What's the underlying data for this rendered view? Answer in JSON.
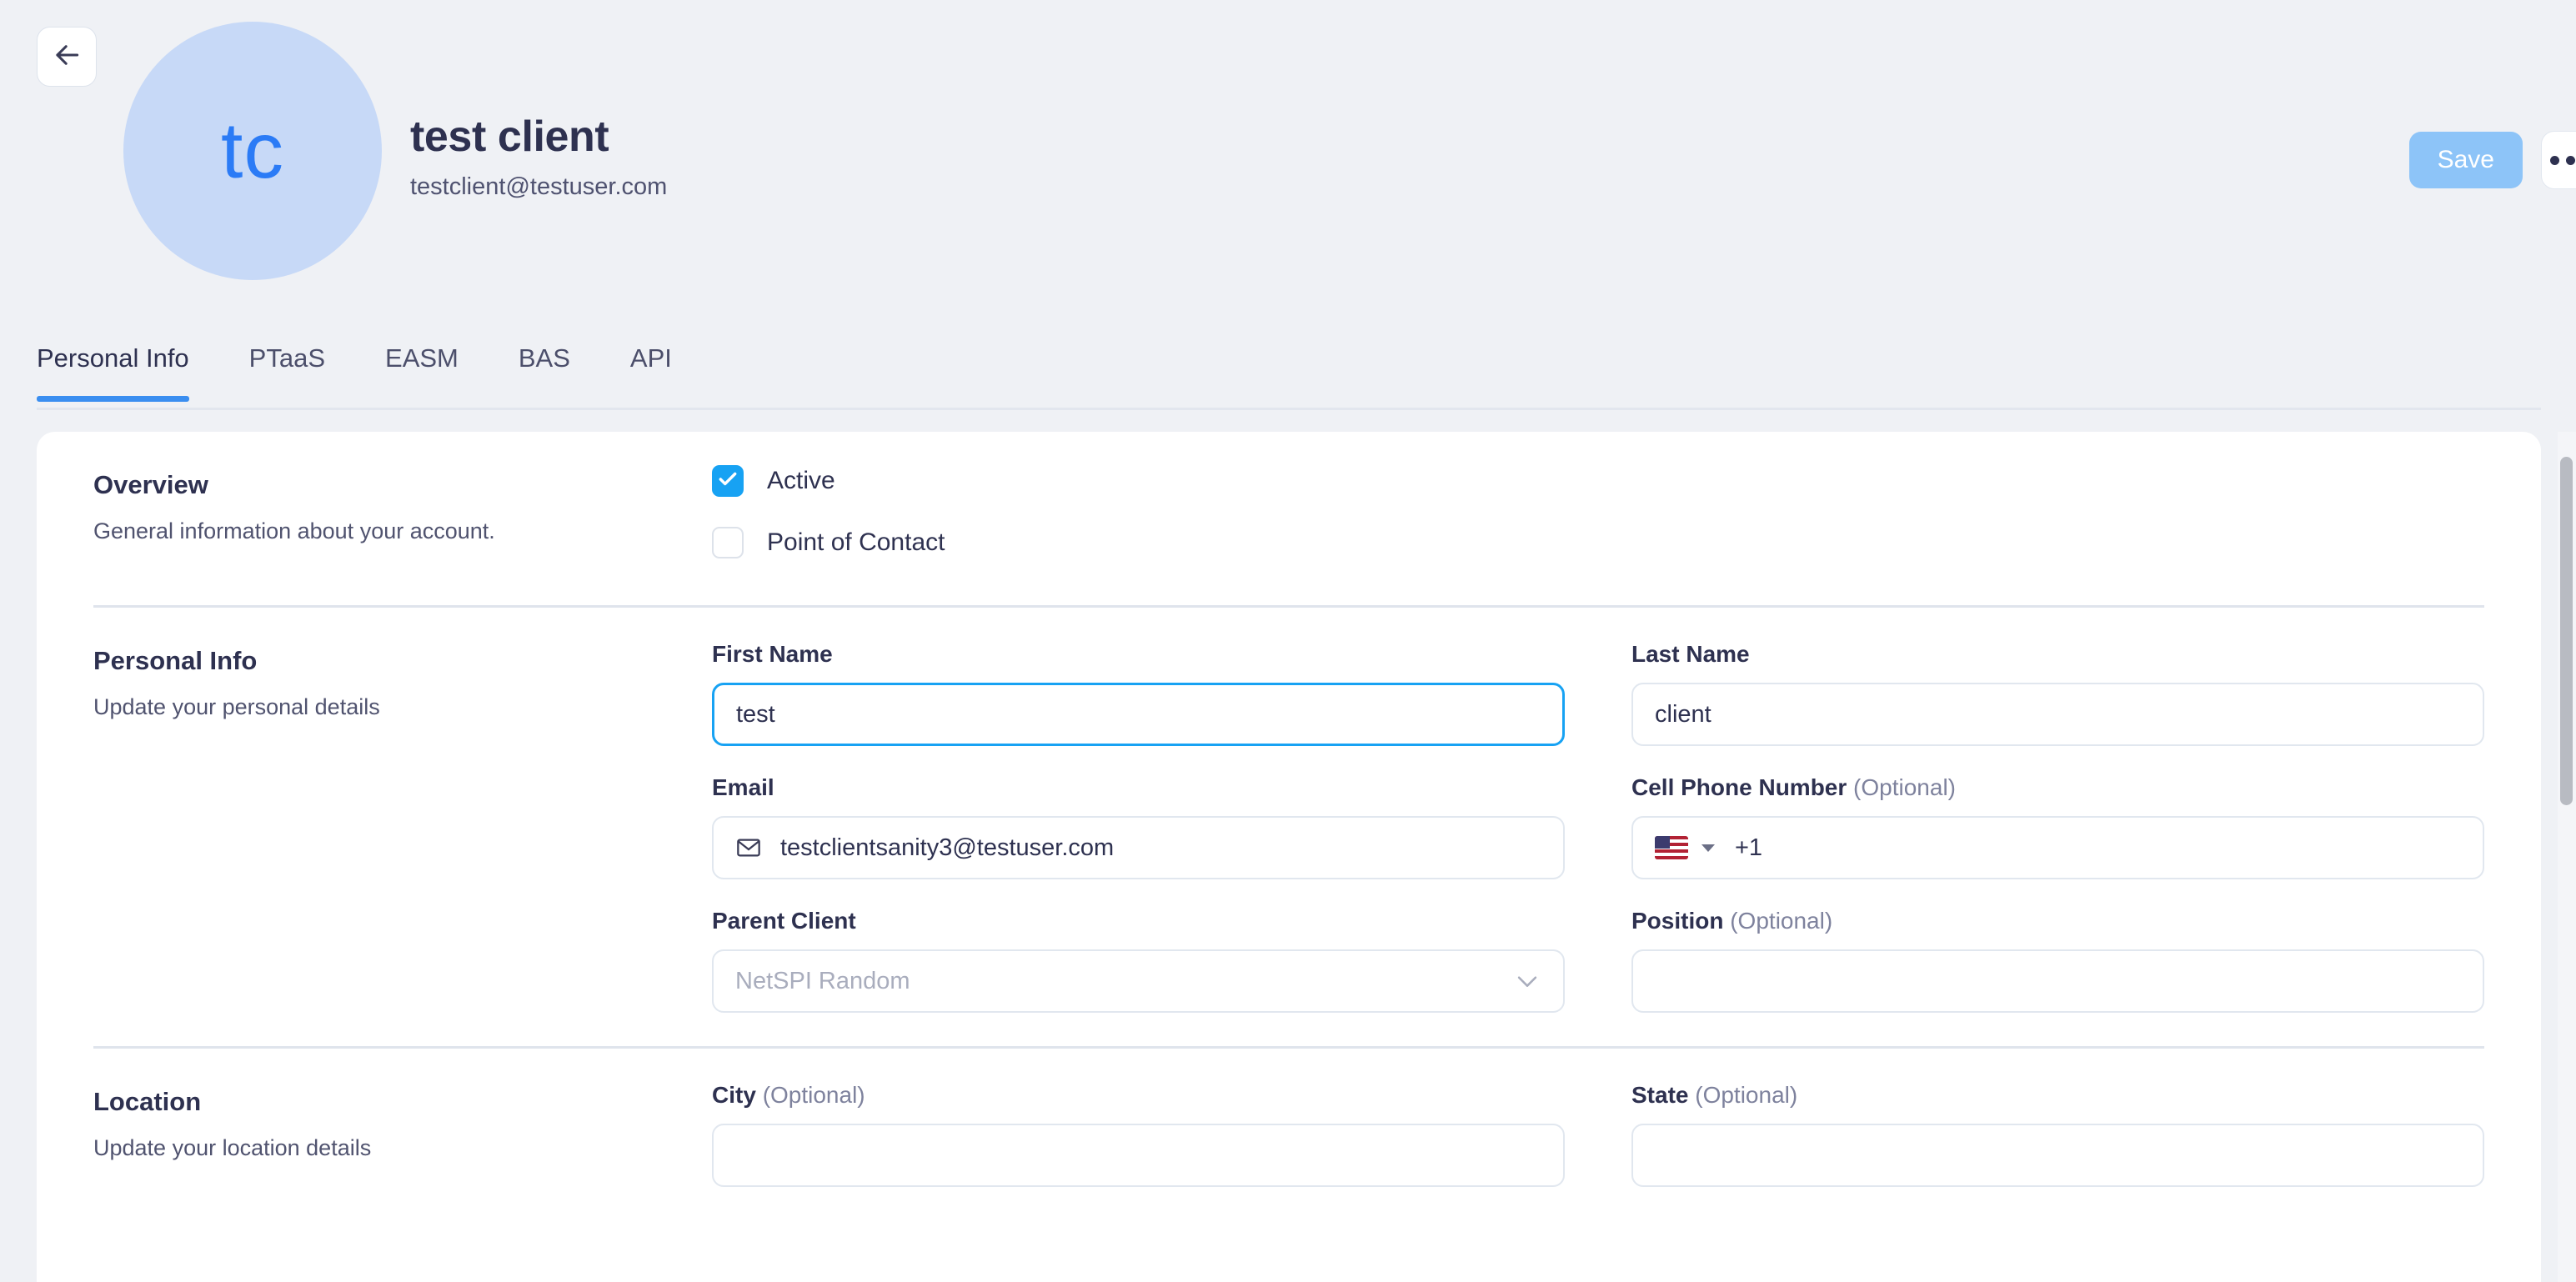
{
  "header": {
    "back_icon": "arrow-left-icon",
    "avatar_initials": "tc",
    "avatar_bg": "#c7d9f7",
    "avatar_fg": "#2b7bf6",
    "name": "test client",
    "email": "testclient@testuser.com",
    "save_label": "Save",
    "save_bg": "#8dc4f8",
    "more_icon": "ellipsis-icon"
  },
  "tabs": {
    "active_color": "#3a8ef0",
    "items": [
      {
        "label": "Personal Info",
        "active": true
      },
      {
        "label": "PTaaS",
        "active": false
      },
      {
        "label": "EASM",
        "active": false
      },
      {
        "label": "BAS",
        "active": false
      },
      {
        "label": "API",
        "active": false
      }
    ]
  },
  "overview": {
    "title": "Overview",
    "subtitle": "General information about your account.",
    "checkboxes": [
      {
        "label": "Active",
        "checked": true,
        "color": "#17a2f3"
      },
      {
        "label": "Point of Contact",
        "checked": false
      }
    ]
  },
  "personal_info": {
    "title": "Personal Info",
    "subtitle": "Update your personal details",
    "fields": {
      "first_name": {
        "label": "First Name",
        "optional": "",
        "value": "test",
        "focused": true
      },
      "last_name": {
        "label": "Last Name",
        "optional": "",
        "value": "client",
        "focused": false
      },
      "email": {
        "label": "Email",
        "optional": "",
        "value": "testclientsanity3@testuser.com",
        "icon": "mail-icon"
      },
      "cell_phone": {
        "label": "Cell Phone Number",
        "optional": "(Optional)",
        "country": "US",
        "dial_code": "+1",
        "value": ""
      },
      "parent_client": {
        "label": "Parent Client",
        "optional": "",
        "placeholder": "NetSPI Random",
        "value": "",
        "icon": "chevron-down-icon"
      },
      "position": {
        "label": "Position",
        "optional": "(Optional)",
        "value": ""
      }
    }
  },
  "location": {
    "title": "Location",
    "subtitle": "Update your location details",
    "fields": {
      "city": {
        "label": "City",
        "optional": "(Optional)",
        "value": ""
      },
      "state": {
        "label": "State",
        "optional": "(Optional)",
        "value": ""
      }
    }
  }
}
